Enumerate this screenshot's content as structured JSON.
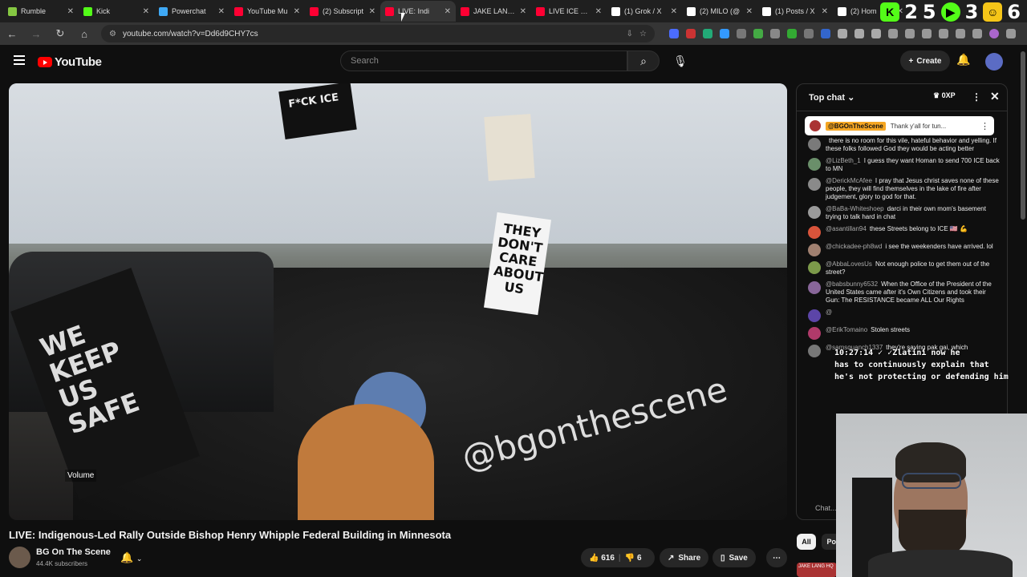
{
  "browser": {
    "tabs": [
      {
        "label": "Rumble",
        "color": "#85c742"
      },
      {
        "label": "Kick",
        "color": "#53fc18"
      },
      {
        "label": "Powerchat",
        "color": "#3fa9f5"
      },
      {
        "label": "YouTube Mu",
        "color": "#ff0033"
      },
      {
        "label": "(2) Subscript",
        "color": "#ff0033"
      },
      {
        "label": "LIVE: Indi",
        "color": "#ff0033",
        "active": true
      },
      {
        "label": "JAKE LANG 2",
        "color": "#ff0033"
      },
      {
        "label": "LIVE ICE CO",
        "color": "#ff0033"
      },
      {
        "label": "(1) Grok / X",
        "color": "#ffffff"
      },
      {
        "label": "(2) MILO (@",
        "color": "#ffffff"
      },
      {
        "label": "(1) Posts / X",
        "color": "#ffffff"
      },
      {
        "label": "(2) Hom",
        "color": "#ffffff"
      }
    ],
    "url": "youtube.com/watch?v=Dd6d9CHY7cs",
    "overlay_numbers": [
      "2",
      "5",
      "3",
      "6"
    ]
  },
  "yt_header": {
    "logo_text": "YouTube",
    "search_placeholder": "Search",
    "create_label": "Create"
  },
  "video": {
    "sign_text": "WE KEEP US SAFE",
    "flag_text": "F*CK ICE",
    "placard_text": "THEY DON'T CARE ABOUT US",
    "watermark": "@bgonthescene",
    "volume_tooltip": "Volume",
    "title": "LIVE: Indigenous-Led Rally Outside Bishop Henry Whipple Federal Building in Minnesota"
  },
  "channel": {
    "name": "BG On The Scene",
    "subscribers": "44.4K subscribers"
  },
  "actions": {
    "likes": "616",
    "dislikes": "6",
    "share": "Share",
    "save": "Save"
  },
  "chat": {
    "header": "Top chat",
    "xp": "0XP",
    "pinned": {
      "name": "@BGOnTheScene",
      "text": "Thank y'all for tun..."
    },
    "messages": [
      {
        "name": "",
        "text": "there is no room for this vile, hateful behavior and yelling. If these folks followed God they would be acting better",
        "color": "#7a7a7a"
      },
      {
        "name": "@LizBeth_1",
        "text": "I guess they want Homan to send 700 ICE back to MN",
        "color": "#6a8f6a"
      },
      {
        "name": "@DerickMcAfee",
        "text": "I pray that Jesus christ saves none of these people, they will find themselves in the lake of fire after judgement, glory to god for that.",
        "color": "#8a8a8a"
      },
      {
        "name": "@BaBa-Whiteshoep",
        "text": "darci in their own mom's basement trying to talk hard in chat",
        "color": "#9a9a9a"
      },
      {
        "name": "@asantillan94",
        "text": "these Streets belong to ICE 🇺🇸 💪",
        "color": "#d9543b"
      },
      {
        "name": "@chickadee-ph8wd",
        "text": "i see the weekenders have arrived. lol",
        "color": "#a08070"
      },
      {
        "name": "@AbbaLovesUs",
        "text": "Not enough police to get them out of the street?",
        "color": "#7c9a4a"
      },
      {
        "name": "@babsbunny6532",
        "text": "When the Office of the President of the United States came after it's Own Citizens and took their Gun: The RESISTANCE became ALL Our Rights",
        "color": "#886699"
      },
      {
        "name": "@",
        "text": "",
        "color": "#5c45a8"
      },
      {
        "name": "@ErikTomaino",
        "text": "Stolen streets",
        "color": "#b03a6a"
      },
      {
        "name": "@samsquanch1337",
        "text": "they're saying pak gai, which",
        "color": "#777777"
      }
    ],
    "input_placeholder": "Chat..."
  },
  "overlay_chat": [
    "10:27:14 ✓ ✓Zlatini  now he",
    "has to continuously explain that",
    "he's not protecting or defending him"
  ],
  "filter_pills": {
    "all": "All",
    "po": "Po"
  },
  "thumb_text": "JAKE LANG HQ"
}
